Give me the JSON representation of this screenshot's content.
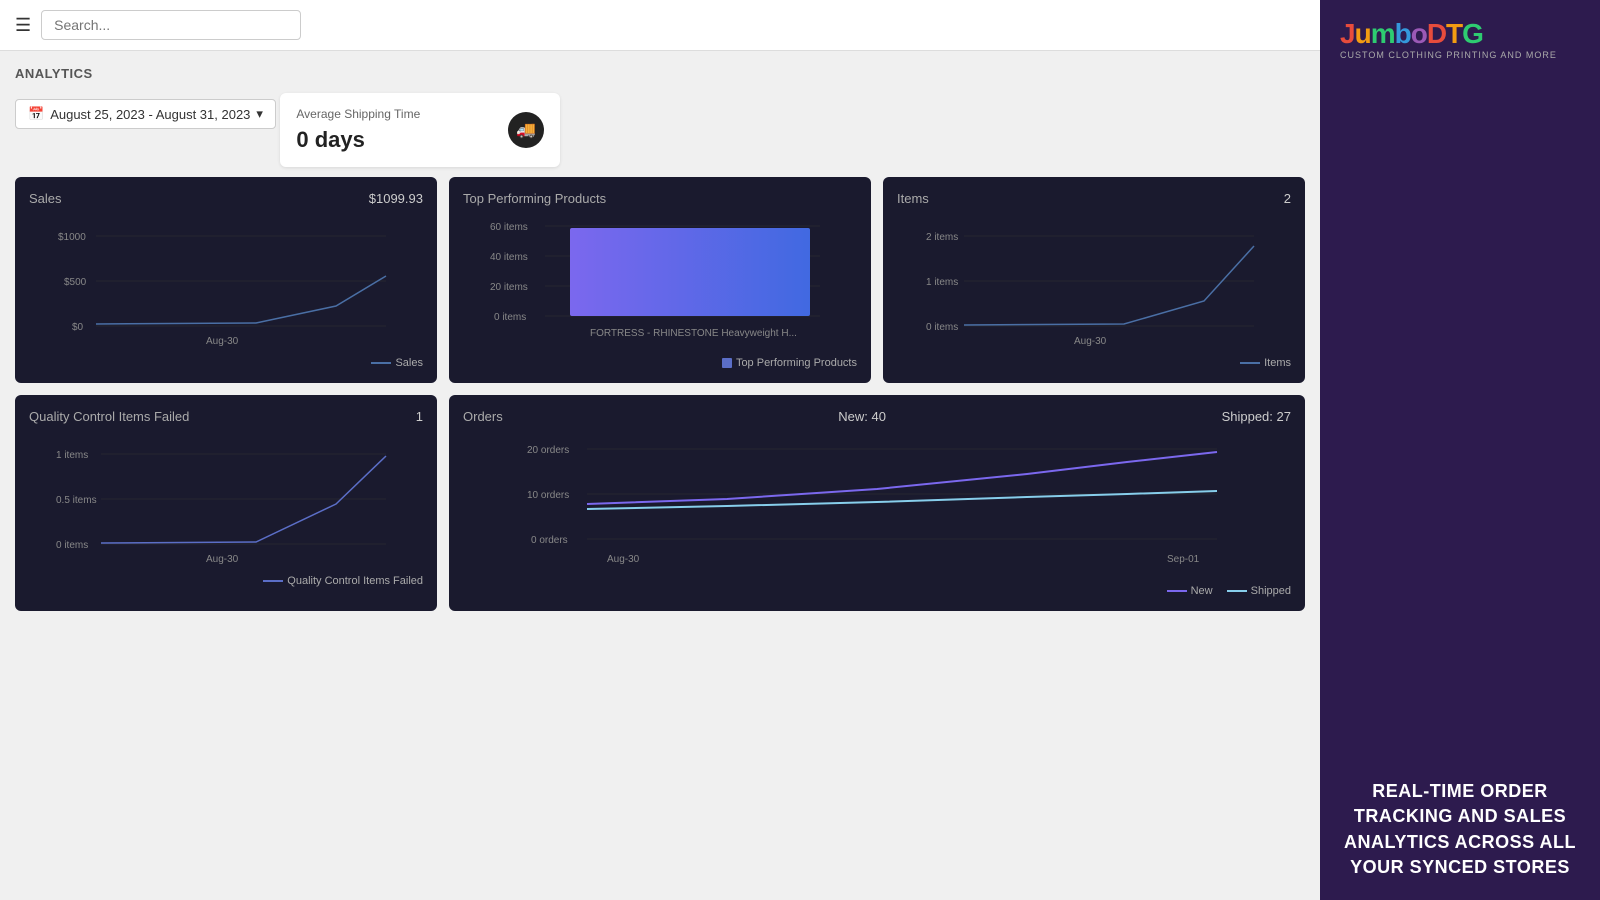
{
  "header": {
    "search_placeholder": "Search...",
    "hamburger_label": "☰"
  },
  "analytics": {
    "title": "ANALYTICS",
    "date_range": "August 25, 2023 - August 31, 2023",
    "date_icon": "📅"
  },
  "shipping_stat": {
    "label": "Average Shipping Time",
    "value": "0 days",
    "icon": "🚚"
  },
  "sales_chart": {
    "title": "Sales",
    "value": "$1099.93",
    "y_labels": [
      "$1000",
      "$500",
      "$0"
    ],
    "x_label": "Aug-30",
    "legend_label": "Sales",
    "legend_color": "#4a6fa5"
  },
  "top_products_chart": {
    "title": "Top Performing Products",
    "y_labels": [
      "60 items",
      "40 items",
      "20 items",
      "0 items"
    ],
    "x_label": "FORTRESS - RHINESTONE Heavyweight H...",
    "legend_label": "Top Performing Products",
    "legend_color": "#5b6ec7"
  },
  "items_chart": {
    "title": "Items",
    "value": "2",
    "y_labels": [
      "2 items",
      "1 items",
      "0 items"
    ],
    "x_label": "Aug-30",
    "legend_label": "Items",
    "legend_color": "#4a6fa5"
  },
  "qc_chart": {
    "title": "Quality Control Items Failed",
    "value": "1",
    "y_labels": [
      "1 items",
      "0.5 items",
      "0 items"
    ],
    "x_label": "Aug-30",
    "legend_label": "Quality Control Items Failed",
    "legend_color": "#5b6ec7"
  },
  "orders_chart": {
    "title": "Orders",
    "new_label": "New:",
    "new_value": "40",
    "shipped_label": "Shipped:",
    "shipped_value": "27",
    "y_labels": [
      "20 orders",
      "10 orders",
      "0 orders"
    ],
    "x_label_left": "Aug-30",
    "x_label_right": "Sep-01",
    "legend_new": "New",
    "legend_new_color": "#7b68ee",
    "legend_shipped": "Shipped",
    "legend_shipped_color": "#87ceeb"
  },
  "sidebar": {
    "logo_letters": [
      "J",
      "u",
      "m",
      "b",
      "o",
      "D",
      "T",
      "G"
    ],
    "logo_subtitle": "CUSTOM CLOTHING PRINTING AND MORE",
    "tagline": "REAL-TIME ORDER TRACKING AND SALES ANALYTICS ACROSS ALL YOUR SYNCED STORES"
  }
}
